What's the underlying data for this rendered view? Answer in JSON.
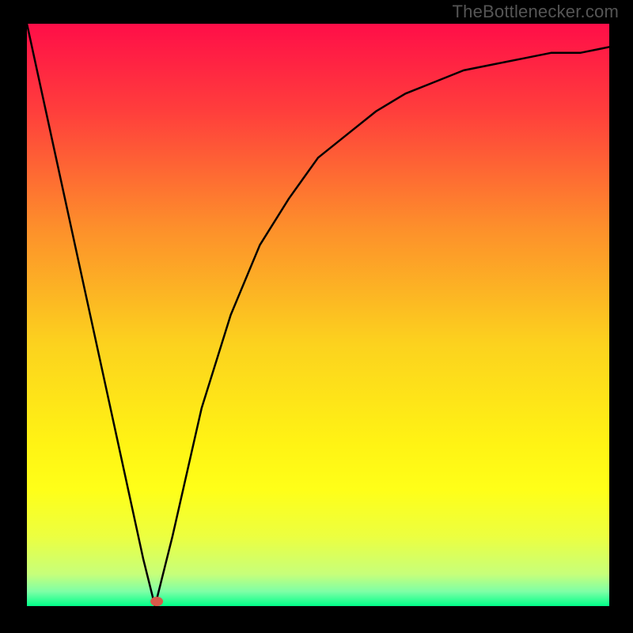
{
  "watermark": "TheBottlenecker.com",
  "chart_data": {
    "type": "line",
    "title": "",
    "xlabel": "",
    "ylabel": "",
    "x": [
      0.0,
      0.05,
      0.1,
      0.15,
      0.2,
      0.22,
      0.25,
      0.3,
      0.35,
      0.4,
      0.45,
      0.5,
      0.55,
      0.6,
      0.65,
      0.7,
      0.75,
      0.8,
      0.85,
      0.9,
      0.95,
      1.0
    ],
    "values": [
      1.0,
      0.77,
      0.54,
      0.31,
      0.08,
      0.0,
      0.12,
      0.34,
      0.5,
      0.62,
      0.7,
      0.77,
      0.81,
      0.85,
      0.88,
      0.9,
      0.92,
      0.93,
      0.94,
      0.95,
      0.95,
      0.96
    ],
    "xlim": [
      0,
      1
    ],
    "ylim": [
      0,
      1
    ],
    "gradient_stops": [
      {
        "offset": 0.0,
        "color": "#ff0e48"
      },
      {
        "offset": 0.15,
        "color": "#ff3e3c"
      },
      {
        "offset": 0.35,
        "color": "#fd8f2b"
      },
      {
        "offset": 0.55,
        "color": "#fcd21e"
      },
      {
        "offset": 0.72,
        "color": "#fff314"
      },
      {
        "offset": 0.8,
        "color": "#ffff18"
      },
      {
        "offset": 0.88,
        "color": "#ecff40"
      },
      {
        "offset": 0.945,
        "color": "#c7ff7a"
      },
      {
        "offset": 0.975,
        "color": "#7effa6"
      },
      {
        "offset": 1.0,
        "color": "#00ff88"
      }
    ],
    "marker": {
      "x": 0.223,
      "y": 0.008,
      "color": "#d85a4a"
    }
  }
}
